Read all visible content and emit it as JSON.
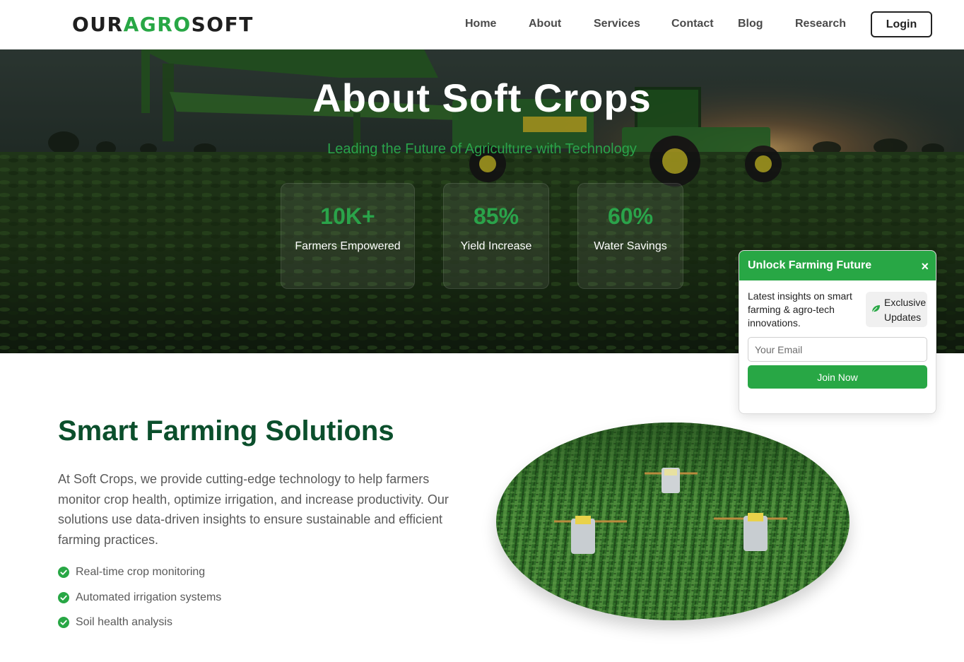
{
  "nav": {
    "logo_part1": "OUR",
    "logo_part2": "AGRO",
    "logo_part3": "SOFT",
    "links": [
      "Home",
      "About",
      "Services",
      "Contact",
      "Blog",
      "Research"
    ],
    "login_label": "Login"
  },
  "hero": {
    "title": "About Soft Crops",
    "subtitle": "Leading the Future of Agriculture with Technology",
    "stats": [
      {
        "value": "10K+",
        "label": "Farmers Empowered"
      },
      {
        "value": "85%",
        "label": "Yield Increase"
      },
      {
        "value": "60%",
        "label": "Water Savings"
      }
    ]
  },
  "solutions": {
    "title": "Smart Farming Solutions",
    "text": "At Soft Crops, we provide cutting-edge technology to help farmers monitor crop health, optimize irrigation, and increase productivity. Our solutions use data-driven insights to ensure sustainable and efficient farming practices.",
    "features": [
      "Real-time crop monitoring",
      "Automated irrigation systems",
      "Soil health analysis"
    ]
  },
  "popup": {
    "title": "Unlock Farming Future",
    "close_icon": "×",
    "description": "Latest insights on smart farming & agro-tech innovations.",
    "badge_line1": "Exclusive",
    "badge_line2": "Updates",
    "email_placeholder": "Your Email",
    "join_label": "Join Now"
  },
  "colors": {
    "brand_green": "#28a745",
    "heading_green": "#0b4f2c"
  }
}
